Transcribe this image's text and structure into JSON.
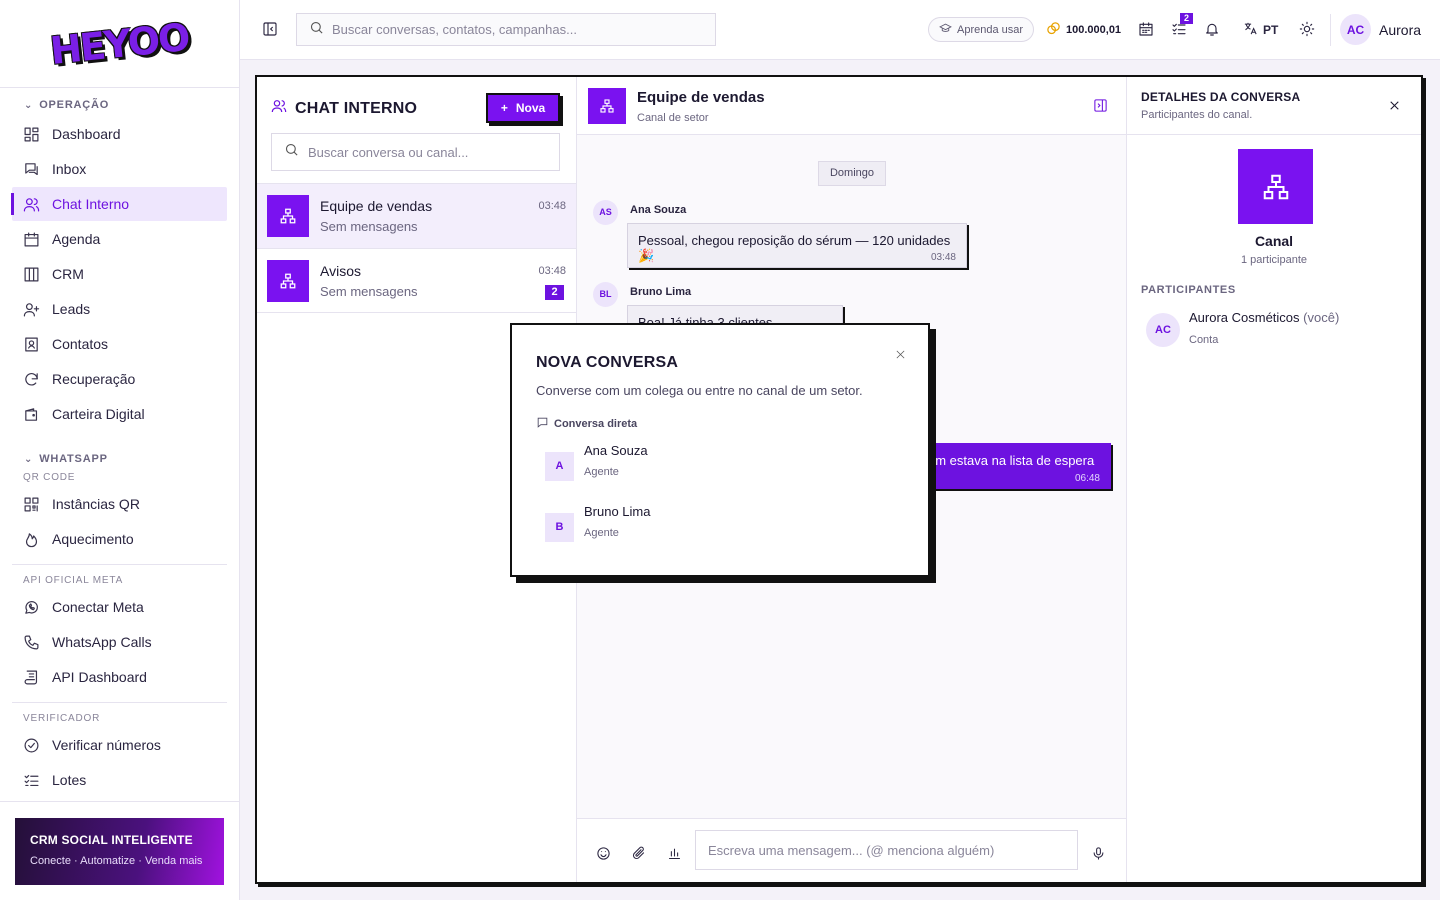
{
  "brand": {
    "logo_text": "HEYOO"
  },
  "sidebar": {
    "sections": [
      {
        "title": "OPERAÇÃO",
        "items": [
          {
            "label": "Dashboard",
            "icon": "dashboard-icon"
          },
          {
            "label": "Inbox",
            "icon": "inbox-icon"
          },
          {
            "label": "Chat Interno",
            "icon": "users-icon",
            "active": true
          },
          {
            "label": "Agenda",
            "icon": "calendar-icon"
          },
          {
            "label": "CRM",
            "icon": "kanban-icon"
          },
          {
            "label": "Leads",
            "icon": "user-plus-icon"
          },
          {
            "label": "Contatos",
            "icon": "contact-book-icon"
          },
          {
            "label": "Recuperação",
            "icon": "refresh-icon"
          },
          {
            "label": "Carteira Digital",
            "icon": "wallet-icon"
          }
        ]
      },
      {
        "title": "WHATSAPP",
        "subtitle": "QR CODE",
        "items": [
          {
            "label": "Instâncias QR",
            "icon": "qr-icon"
          },
          {
            "label": "Aquecimento",
            "icon": "flame-icon"
          }
        ]
      },
      {
        "subtitle": "API OFICIAL META",
        "items": [
          {
            "label": "Conectar Meta",
            "icon": "whatsapp-icon"
          },
          {
            "label": "WhatsApp Calls",
            "icon": "phone-icon"
          },
          {
            "label": "API Dashboard",
            "icon": "scroll-icon"
          }
        ]
      },
      {
        "subtitle": "VERIFICADOR",
        "items": [
          {
            "label": "Verificar números",
            "icon": "check-circle-icon"
          },
          {
            "label": "Lotes",
            "icon": "list-check-icon"
          }
        ]
      }
    ],
    "promo": {
      "title": "CRM SOCIAL INTELIGENTE",
      "subtitle": "Conecte · Automatize · Venda mais"
    }
  },
  "topbar": {
    "search_placeholder": "Buscar conversas, contatos, campanhas...",
    "learn_label": "Aprenda usar",
    "credits": "100.000,01",
    "tasks_badge": "2",
    "language": "PT",
    "user_initials": "AC",
    "user_name": "Aurora"
  },
  "chat_list": {
    "title": "CHAT INTERNO",
    "new_button": "Nova",
    "search_placeholder": "Buscar conversa ou canal...",
    "items": [
      {
        "name": "Equipe de vendas",
        "last": "Sem mensagens",
        "time": "03:48",
        "badge": ""
      },
      {
        "name": "Avisos",
        "last": "Sem mensagens",
        "time": "03:48",
        "badge": "2"
      }
    ]
  },
  "conversation": {
    "title": "Equipe de vendas",
    "subtitle": "Canal de setor",
    "day": "Domingo",
    "messages": [
      {
        "initials": "AS",
        "author": "Ana Souza",
        "text": "Pessoal, chegou reposição do sérum — 120 unidades 🎉",
        "time": "03:48"
      },
      {
        "initials": "BL",
        "author": "Bruno Lima",
        "text": "Boa! Já tinha 3 clientes esperando",
        "time": ""
      },
      {
        "mine": true,
        "text": "em estava na lista de espera",
        "time": "06:48"
      }
    ],
    "composer_placeholder": "Escreva uma mensagem... (@ menciona alguém)"
  },
  "details": {
    "title": "DETALHES DA CONVERSA",
    "subtitle": "Participantes do canal.",
    "name": "Canal",
    "count": "1 participante",
    "section": "PARTICIPANTES",
    "participants": [
      {
        "initials": "AC",
        "name": "Aurora Cosméticos",
        "suffix": "(você)",
        "role": "Conta"
      }
    ]
  },
  "modal": {
    "title": "NOVA CONVERSA",
    "subtitle": "Converse com um colega ou entre no canal de um setor.",
    "section": "Conversa direta",
    "items": [
      {
        "initial": "A",
        "name": "Ana Souza",
        "role": "Agente"
      },
      {
        "initial": "B",
        "name": "Bruno Lima",
        "role": "Agente"
      }
    ]
  },
  "colors": {
    "accent": "#6d12e0",
    "accent_bright": "#7a12f0",
    "border_dark": "#111111"
  }
}
